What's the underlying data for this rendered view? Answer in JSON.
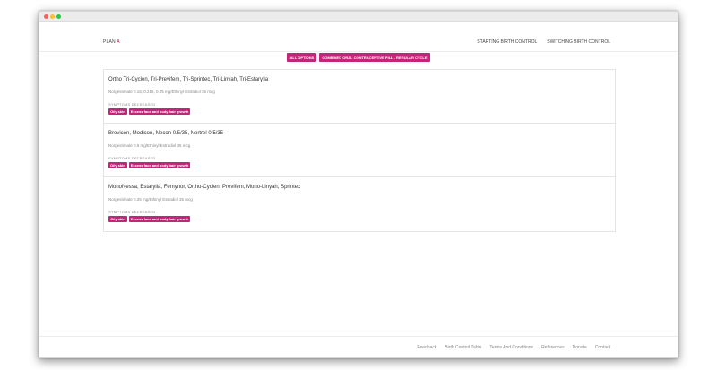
{
  "brand": {
    "name": "PLAN",
    "accent": "A",
    "accent_color": "#c2185b"
  },
  "nav": {
    "links": [
      "STARTING BIRTH CONTROL",
      "SWITCHING BIRTH CONTROL"
    ]
  },
  "filters": [
    "ALL OPTIONS",
    "COMBINED ORAL CONTRACEPTIVE PILL - REGULAR CYCLE"
  ],
  "results": [
    {
      "title": "Ortho Tri-Cyclen, Tri-Previfem, Tri-Sprintec, Tri-Linyah, Tri-Estarylla",
      "subtitle": "Norgestimate 0.18, 0.215, 0.25 mg/Ethinyl Estradiol 35 mcg",
      "label": "SYMPTOMS DECREASED",
      "tags": [
        "Oily skin",
        "Excess face and body hair growth"
      ]
    },
    {
      "title": "Brevicon, Modicon, Necon 0.5/35, Nortrel 0.5/35",
      "subtitle": "Norgestimate 0.5 mg/Ethinyl Estradiol 35 mcg",
      "label": "SYMPTOMS DECREASED",
      "tags": [
        "Oily skin",
        "Excess face and body hair growth"
      ]
    },
    {
      "title": "MonoNessa, Estarylla, Femynor, Ortho-Cyclen, Previfem, Mono-Linyah, Sprintec",
      "subtitle": "Norgestimate 0.25 mg/Ethinyl Estradiol 35 mcg",
      "label": "SYMPTOMS DECREASED",
      "tags": [
        "Oily skin",
        "Excess face and body hair growth"
      ]
    }
  ],
  "footer": {
    "links": [
      "Feedback",
      "Birth Control Table",
      "Terms And Conditions",
      "References",
      "Donate",
      "Contact"
    ]
  },
  "colors": {
    "accent": "#c2267a"
  }
}
